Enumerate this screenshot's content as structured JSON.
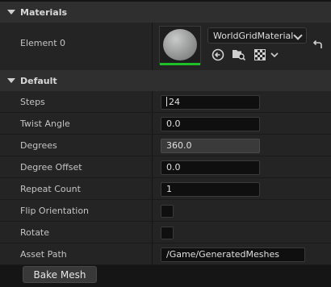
{
  "materials": {
    "header": "Materials",
    "element_label": "Element 0",
    "material_name": "WorldGridMaterial"
  },
  "default": {
    "header": "Default",
    "rows": [
      {
        "label": "Steps",
        "value": "24"
      },
      {
        "label": "Twist Angle",
        "value": "0.0"
      },
      {
        "label": "Degrees",
        "value": "360.0"
      },
      {
        "label": "Degree Offset",
        "value": "0.0"
      },
      {
        "label": "Repeat Count",
        "value": "1"
      },
      {
        "label": "Flip Orientation",
        "value": ""
      },
      {
        "label": "Rotate",
        "value": ""
      },
      {
        "label": "Asset Path",
        "value": "/Game/GeneratedMeshes"
      }
    ],
    "bake_button": "Bake Mesh"
  },
  "colors": {
    "background": "#151515",
    "row": "#242424",
    "header": "#2f2f2f",
    "thumbnail_indicator": "#1fbf28"
  }
}
